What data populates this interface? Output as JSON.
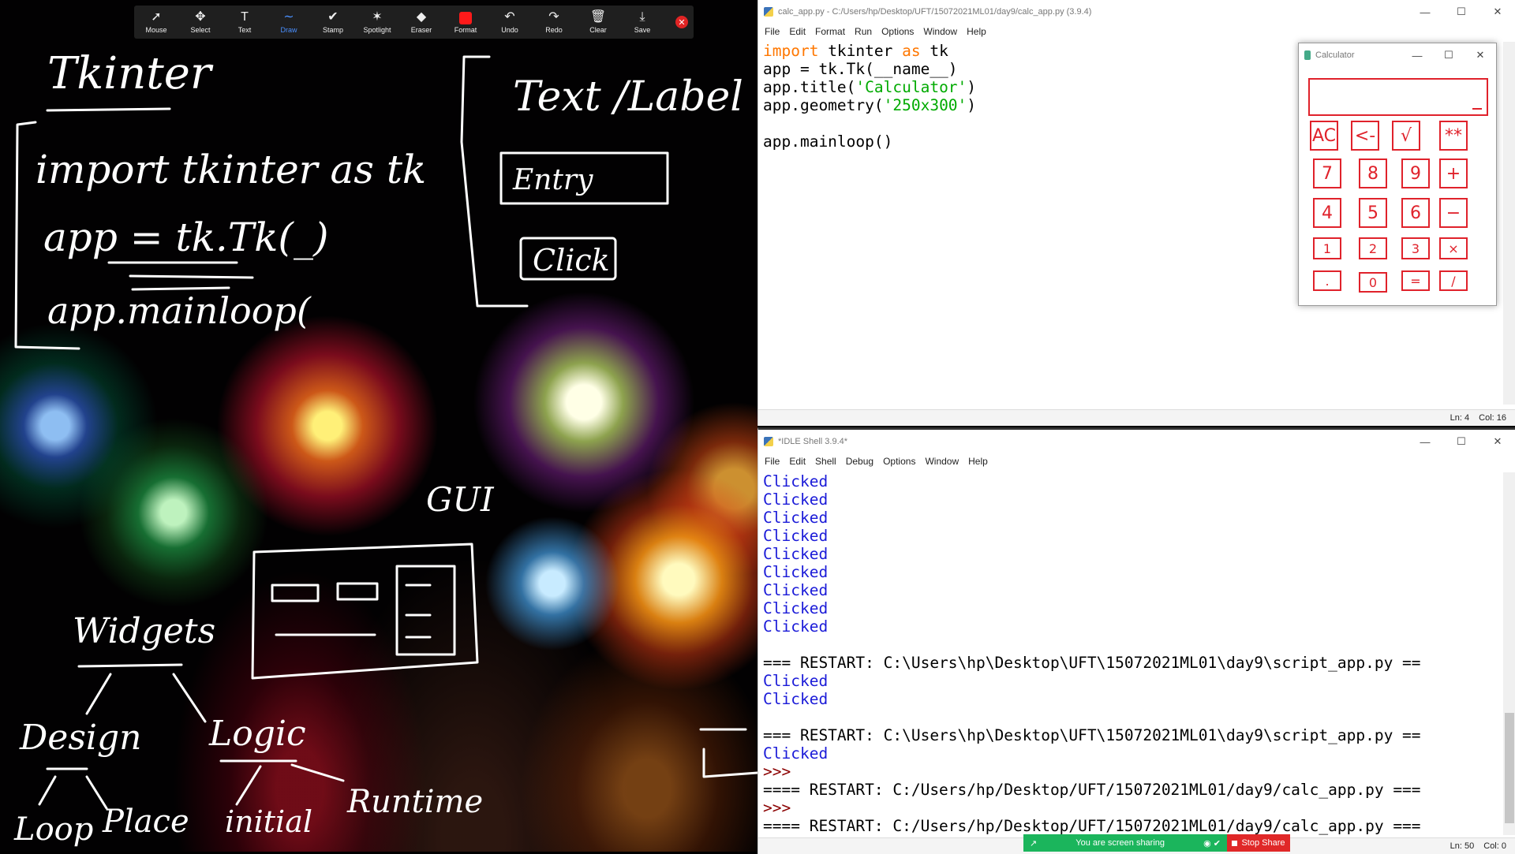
{
  "zoom_toolbar": {
    "tools": [
      {
        "label": "Mouse",
        "icon": "mouse-icon",
        "glyph": "➚"
      },
      {
        "label": "Select",
        "icon": "select-icon",
        "glyph": "✥"
      },
      {
        "label": "Text",
        "icon": "text-icon",
        "glyph": "T"
      },
      {
        "label": "Draw",
        "icon": "draw-icon",
        "glyph": "∼",
        "active": true
      },
      {
        "label": "Stamp",
        "icon": "stamp-icon",
        "glyph": "✔"
      },
      {
        "label": "Spotlight",
        "icon": "spotlight-icon",
        "glyph": "✶"
      },
      {
        "label": "Eraser",
        "icon": "eraser-icon",
        "glyph": "◆"
      },
      {
        "label": "Format",
        "icon": "format-icon",
        "swatch": "#ff1a1a"
      },
      {
        "label": "Undo",
        "icon": "undo-icon",
        "glyph": "↶"
      },
      {
        "label": "Redo",
        "icon": "redo-icon",
        "glyph": "↷"
      },
      {
        "label": "Clear",
        "icon": "clear-icon",
        "glyph": "🗑"
      },
      {
        "label": "Save",
        "icon": "save-icon",
        "glyph": "⤓"
      }
    ],
    "close_glyph": "✕"
  },
  "board": {
    "notes": {
      "tkinter": "Tkinter",
      "import_line": "import tkinter as tk",
      "app_line": "app = tk.Tk(_)",
      "mainloop_line": "app.mainloop(",
      "text_label": "Text /Label",
      "entry": "Entry",
      "click": "Click",
      "gui": "GUI",
      "widgets": "Widgets",
      "design": "Design",
      "logic": "Logic",
      "loop": "Loop",
      "place": "Place",
      "initial": "initial",
      "runtime": "Runtime"
    }
  },
  "editor": {
    "title": "calc_app.py - C:/Users/hp/Desktop/UFT/15072021ML01/day9/calc_app.py (3.9.4)",
    "menu": [
      "File",
      "Edit",
      "Format",
      "Run",
      "Options",
      "Window",
      "Help"
    ],
    "code": {
      "l1_kw1": "import",
      "l1_mid": " tkinter ",
      "l1_kw2": "as",
      "l1_end": " tk",
      "l2": "app = tk.Tk(__name__)",
      "l3_pre": "app.title(",
      "l3_str": "'Calculator'",
      "l3_post": ")",
      "l4_pre": "app.geometry(",
      "l4_str": "'250x300'",
      "l4_post": ")",
      "l5": "",
      "l6": "app.mainloop()"
    },
    "status": {
      "ln": "Ln: 4",
      "col": "Col: 16"
    }
  },
  "calculator": {
    "title": "Calculator",
    "buttons": [
      "AC",
      "<-",
      "√",
      "**",
      "7",
      "8",
      "9",
      "+",
      "4",
      "5",
      "6",
      "−",
      "1",
      "2",
      "3",
      "×",
      ".",
      "0",
      "=",
      "/"
    ],
    "accent": "#e0222b"
  },
  "shell": {
    "title": "*IDLE Shell 3.9.4*",
    "menu": [
      "File",
      "Edit",
      "Shell",
      "Debug",
      "Options",
      "Window",
      "Help"
    ],
    "lines": [
      {
        "t": "Clicked",
        "c": "out"
      },
      {
        "t": "Clicked",
        "c": "out"
      },
      {
        "t": "Clicked",
        "c": "out"
      },
      {
        "t": "Clicked",
        "c": "out"
      },
      {
        "t": "Clicked",
        "c": "out"
      },
      {
        "t": "Clicked",
        "c": "out"
      },
      {
        "t": "Clicked",
        "c": "out"
      },
      {
        "t": "Clicked",
        "c": "out"
      },
      {
        "t": "Clicked",
        "c": "out"
      },
      {
        "t": "",
        "c": "plain"
      },
      {
        "t": "=== RESTART: C:\\Users\\hp\\Desktop\\UFT\\15072021ML01\\day9\\script_app.py ==",
        "c": "plain"
      },
      {
        "t": "Clicked",
        "c": "out"
      },
      {
        "t": "Clicked",
        "c": "out"
      },
      {
        "t": "",
        "c": "plain"
      },
      {
        "t": "=== RESTART: C:\\Users\\hp\\Desktop\\UFT\\15072021ML01\\day9\\script_app.py ==",
        "c": "plain"
      },
      {
        "t": "Clicked",
        "c": "out"
      },
      {
        "t": ">>>",
        "c": "prompt"
      },
      {
        "t": "==== RESTART: C:/Users/hp/Desktop/UFT/15072021ML01/day9/calc_app.py ===",
        "c": "plain"
      },
      {
        "t": ">>>",
        "c": "prompt"
      },
      {
        "t": "==== RESTART: C:/Users/hp/Desktop/UFT/15072021ML01/day9/calc_app.py ===",
        "c": "plain"
      }
    ],
    "status": {
      "ln": "Ln: 50",
      "col": "Col: 0"
    }
  },
  "sharebar": {
    "status": "You are screen sharing",
    "stop": "Stop Share"
  },
  "window_controls": {
    "min": "—",
    "max": "☐",
    "close": "✕"
  }
}
